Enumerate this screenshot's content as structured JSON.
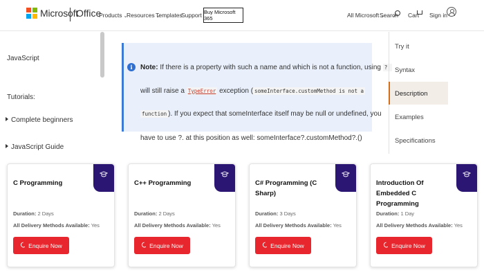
{
  "header": {
    "brand": "Microsoft",
    "product": "Office",
    "nav": [
      {
        "label": "Products",
        "has_dropdown": true
      },
      {
        "label": "Resources",
        "has_dropdown": true
      },
      {
        "label": "Templates",
        "has_dropdown": false
      },
      {
        "label": "Support",
        "has_dropdown": false
      }
    ],
    "buy_label": "Buy Microsoft 365",
    "all_microsoft": "All Microsoft",
    "search_label": "Search",
    "cart_label": "Cart",
    "signin_label": "Sign in",
    "logo_colors": [
      "#f25022",
      "#7fba00",
      "#00a4ef",
      "#ffb900"
    ]
  },
  "sidebar": {
    "title": "JavaScript",
    "tutorials_label": "Tutorials:",
    "items": [
      "Complete beginners",
      "JavaScript Guide"
    ]
  },
  "note": {
    "label": "Note:",
    "line1": "If there is a property with such a name and which is not a function, using",
    "op1": "?.",
    "line2a": "will still raise a",
    "code_error": "TypeError",
    "line2b": "exception (",
    "code_method": "someInterface.customMethod is not a",
    "code_function": "function",
    "line3": "). If you expect that someInterface itself may be null or undefined, you",
    "line4": "have to use ?. at this position as well: someInterface?.customMethod?.()"
  },
  "toc": {
    "items": [
      "Try it",
      "Syntax",
      "Description",
      "Examples",
      "Specifications"
    ],
    "active": "Description",
    "accent": "#d46d1a"
  },
  "cards": [
    {
      "title": "C Programming",
      "duration_label": "Duration:",
      "duration": "2 Days",
      "delivery_label": "All Delivery Methods Available:",
      "delivery": "Yes",
      "button": "Enquire Now"
    },
    {
      "title": "C++ Programming",
      "duration_label": "Duration:",
      "duration": "2 Days",
      "delivery_label": "All Delivery Methods Available:",
      "delivery": "Yes",
      "button": "Enquire Now"
    },
    {
      "title": "C# Programming (C Sharp)",
      "duration_label": "Duration:",
      "duration": "3 Days",
      "delivery_label": "All Delivery Methods Available:",
      "delivery": "Yes",
      "button": "Enquire Now"
    },
    {
      "title": "Introduction Of Embedded C Programming",
      "duration_label": "Duration:",
      "duration": "1 Day",
      "delivery_label": "All Delivery Methods Available:",
      "delivery": "Yes",
      "button": "Enquire Now"
    }
  ],
  "colors": {
    "badge": "#2c1673",
    "enquire": "#e8262d",
    "note_bg": "#e9f0fb",
    "note_accent": "#3d7ad6"
  }
}
